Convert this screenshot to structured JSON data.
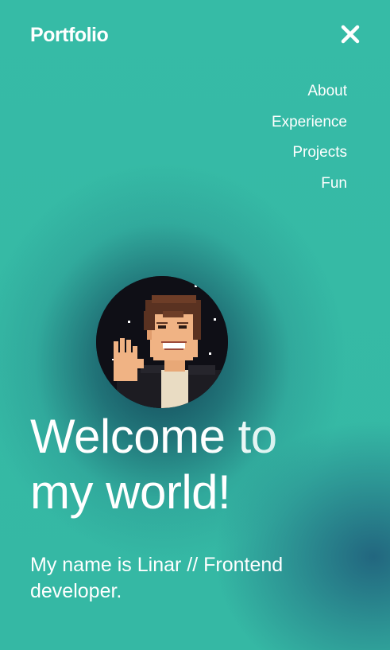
{
  "header": {
    "logo_text": "Portfolio",
    "close_icon": "close-icon"
  },
  "nav": {
    "items": [
      {
        "label": "About"
      },
      {
        "label": "Experience"
      },
      {
        "label": "Projects"
      },
      {
        "label": "Fun"
      }
    ]
  },
  "hero": {
    "avatar_icon": "avatar-waving-pixel-art",
    "headline_line1": "Welcome to",
    "headline_line2": "my world!",
    "subtitle": "My name is Linar // Frontend developer."
  },
  "colors": {
    "background": "#35b9a5",
    "text": "#ffffff",
    "dark_glow": "#103e52"
  }
}
